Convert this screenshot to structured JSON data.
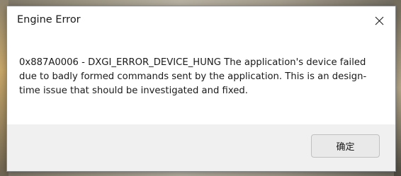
{
  "dialog": {
    "title": "Engine Error",
    "message": "0x887A0006 - DXGI_ERROR_DEVICE_HUNG The application's device failed due to badly formed commands sent by the application. This is an design-time issue that should be investigated and fixed.",
    "ok_label": "确定",
    "close_icon": "close-icon"
  }
}
